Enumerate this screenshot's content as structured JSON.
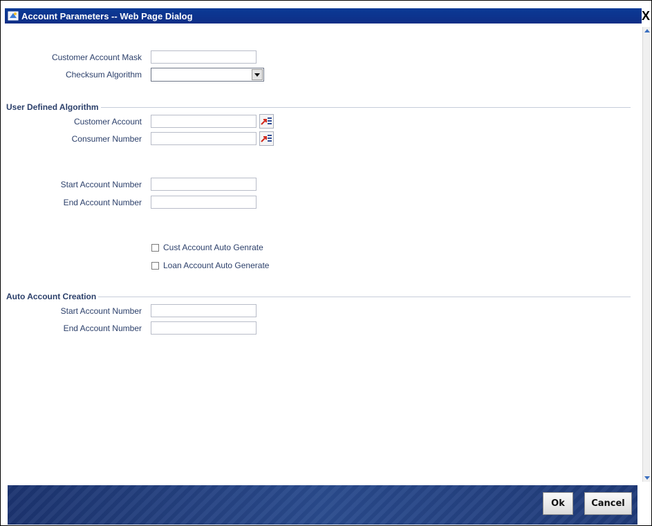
{
  "window": {
    "title": "Account Parameters -- Web Page Dialog",
    "close_glyph": "X"
  },
  "top_fields": {
    "customer_account_mask": {
      "label": "Customer Account Mask",
      "value": ""
    },
    "checksum_algorithm": {
      "label": "Checksum Algorithm",
      "value": ""
    }
  },
  "user_defined_algorithm": {
    "legend": "User Defined Algorithm",
    "customer_account": {
      "label": "Customer Account",
      "value": ""
    },
    "consumer_number": {
      "label": "Consumer Number",
      "value": ""
    },
    "start_account_number": {
      "label": "Start Account Number",
      "value": ""
    },
    "end_account_number": {
      "label": "End Account Number",
      "value": ""
    }
  },
  "checkboxes": {
    "cust_auto": {
      "label": "Cust Account Auto Genrate",
      "checked": false
    },
    "loan_auto": {
      "label": "Loan Account Auto Generate",
      "checked": false
    }
  },
  "auto_account_creation": {
    "legend": "Auto Account Creation",
    "start_account_number": {
      "label": "Start Account Number",
      "value": ""
    },
    "end_account_number": {
      "label": "End Account Number",
      "value": ""
    }
  },
  "footer": {
    "ok_label": "Ok",
    "cancel_label": "Cancel"
  },
  "icons": {
    "app": "dialog-app-icon",
    "lov": "list-of-values-icon",
    "dropdown": "chevron-down-icon"
  },
  "colors": {
    "title_bar": "#0f2e86",
    "label_text": "#2b3f6a",
    "footer_band": "#2a4b8d",
    "lov_accent": "#d22b1f"
  }
}
